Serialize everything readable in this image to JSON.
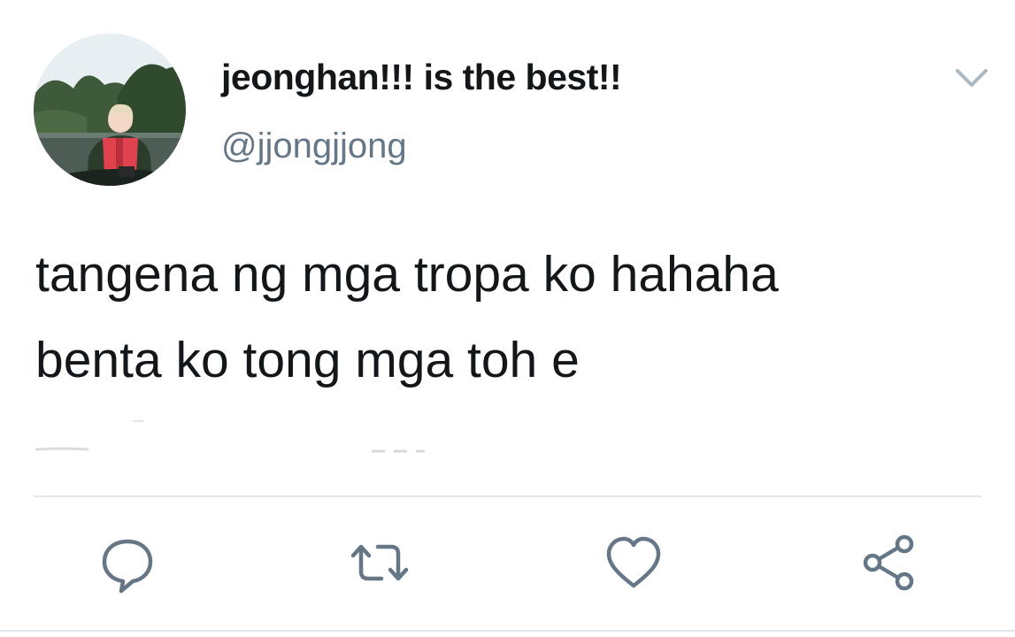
{
  "user": {
    "display_name": "jeonghan!!! is the best!!",
    "handle": "@jjongjjong"
  },
  "tweet": {
    "lines": [
      "tangena ng mga tropa ko hahaha",
      "benta ko tong mga toh e"
    ]
  },
  "icons": {
    "avatar": "profile-photo",
    "menu": "chevron-down-icon",
    "reply": "reply-icon",
    "retweet": "retweet-icon",
    "like": "heart-icon",
    "share": "share-icon"
  },
  "colors": {
    "text": "#14171a",
    "secondary": "#657786",
    "divider": "#e1e8ed",
    "caret": "#aab8c2"
  }
}
